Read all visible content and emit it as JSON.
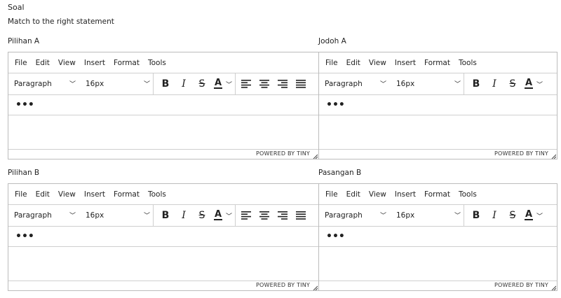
{
  "question": {
    "title": "Soal",
    "description": "Match to the right statement"
  },
  "icons": {
    "more": "more-horizontal-icon",
    "chevron": "chevron-down-icon",
    "bold": "bold-icon",
    "italic": "italic-icon",
    "strike": "strikethrough-icon",
    "text_color": "text-color-icon",
    "align_left": "align-left-icon",
    "align_center": "align-center-icon",
    "align_right": "align-right-icon",
    "align_justify": "align-justify-icon",
    "resize": "resize-handle-icon"
  },
  "editors": [
    {
      "label": "Pilihan A",
      "menu": [
        "File",
        "Edit",
        "View",
        "Insert",
        "Format",
        "Tools"
      ],
      "block_format": "Paragraph",
      "font_size": "16px",
      "more": "•••",
      "branding": "POWERED BY TINY"
    },
    {
      "label": "Jodoh A",
      "menu": [
        "File",
        "Edit",
        "View",
        "Insert",
        "Format",
        "Tools"
      ],
      "block_format": "Paragraph",
      "font_size": "16px",
      "more": "•••",
      "branding": "POWERED BY TINY"
    },
    {
      "label": "Pilihan B",
      "menu": [
        "File",
        "Edit",
        "View",
        "Insert",
        "Format",
        "Tools"
      ],
      "block_format": "Paragraph",
      "font_size": "16px",
      "more": "•••",
      "branding": "POWERED BY TINY"
    },
    {
      "label": "Pasangan B",
      "menu": [
        "File",
        "Edit",
        "View",
        "Insert",
        "Format",
        "Tools"
      ],
      "block_format": "Paragraph",
      "font_size": "16px",
      "more": "•••",
      "branding": "POWERED BY TINY"
    }
  ]
}
